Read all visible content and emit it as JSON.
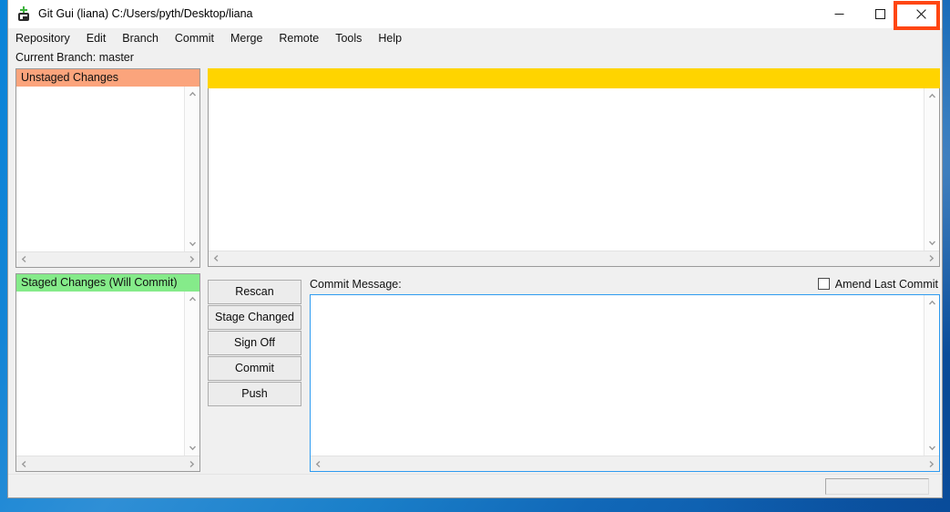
{
  "window": {
    "title": "Git Gui (liana) C:/Users/pyth/Desktop/liana",
    "app_icon": "git-gui-icon",
    "controls": {
      "minimize": "minimize-icon",
      "maximize": "maximize-icon",
      "close": "close-icon"
    },
    "close_highlight_color": "#ff4612"
  },
  "menubar": {
    "items": [
      {
        "label": "Repository"
      },
      {
        "label": "Edit"
      },
      {
        "label": "Branch"
      },
      {
        "label": "Commit"
      },
      {
        "label": "Merge"
      },
      {
        "label": "Remote"
      },
      {
        "label": "Tools"
      },
      {
        "label": "Help"
      }
    ]
  },
  "branch": {
    "text": "Current Branch: master"
  },
  "panels": {
    "unstaged": {
      "header": "Unstaged Changes",
      "header_color": "#fba47c",
      "items": []
    },
    "staged": {
      "header": "Staged Changes (Will Commit)",
      "header_color": "#85eb8a",
      "items": []
    },
    "diff": {
      "header_text": "",
      "header_color": "#ffd400",
      "content": ""
    }
  },
  "buttons": [
    {
      "label": "Rescan"
    },
    {
      "label": "Stage Changed"
    },
    {
      "label": "Sign Off"
    },
    {
      "label": "Commit"
    },
    {
      "label": "Push"
    }
  ],
  "commit": {
    "label": "Commit Message:",
    "amend_label": "Amend Last Commit",
    "amend_checked": false,
    "message_value": ""
  },
  "statusbar": {
    "text": "",
    "progress": ""
  },
  "icons": {
    "chevron_up": "chevron-up-icon",
    "chevron_down": "chevron-down-icon",
    "chevron_left": "chevron-left-icon",
    "chevron_right": "chevron-right-icon"
  }
}
